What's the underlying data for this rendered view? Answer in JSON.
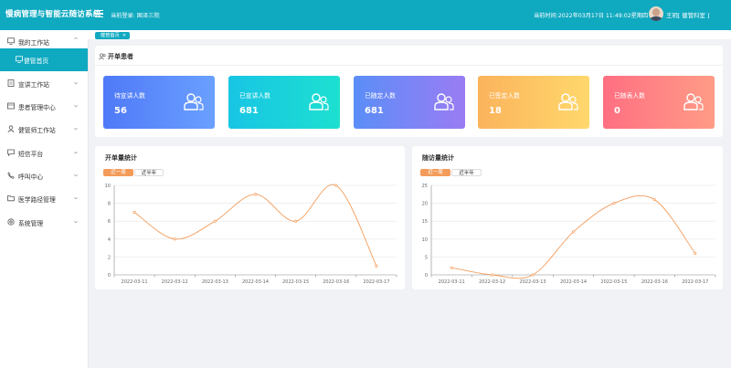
{
  "header": {
    "title": "慢病管理与智能云随访系统",
    "login_text": "当前登录: 国泽三院",
    "time_text": "当前时间:2022年03月17日 11:49:02星期四",
    "user_text": "王玥[ 健管科室 ]"
  },
  "sidebar": {
    "items": [
      {
        "label": "我的工作站",
        "icon": "monitor-icon"
      },
      {
        "label": "健管首页",
        "icon": "monitor-icon"
      },
      {
        "label": "宣讲工作站",
        "icon": "doc-icon"
      },
      {
        "label": "患者管理中心",
        "icon": "card-icon"
      },
      {
        "label": "健管师工作站",
        "icon": "user-icon"
      },
      {
        "label": "短信平台",
        "icon": "chat-icon"
      },
      {
        "label": "呼叫中心",
        "icon": "phone-icon"
      },
      {
        "label": "医学路径管理",
        "icon": "folder-icon"
      },
      {
        "label": "系统管理",
        "icon": "gear-icon"
      }
    ]
  },
  "tabbar": {
    "active_tab": "健管首页",
    "close": "×"
  },
  "patients": {
    "title": "开单患者",
    "tiles": [
      {
        "label": "待宣讲人数",
        "value": "56",
        "from": "#4f79f7",
        "to": "#6aa0ff"
      },
      {
        "label": "已宣讲人数",
        "value": "681",
        "from": "#18c5e4",
        "to": "#1de0d0"
      },
      {
        "label": "已随定人数",
        "value": "681",
        "from": "#5b8ef7",
        "to": "#9a7cf4"
      },
      {
        "label": "已签定人数",
        "value": "18",
        "from": "#fbb35c",
        "to": "#ffd86c"
      },
      {
        "label": "已随表人数",
        "value": "0",
        "from": "#ff6f82",
        "to": "#ff9c86"
      }
    ]
  },
  "charts": {
    "left": {
      "title": "开单量统计",
      "tab_on": "近一周",
      "tab_off": "近半年"
    },
    "right": {
      "title": "随访量统计",
      "tab_on": "近一周",
      "tab_off": "近半年"
    }
  },
  "chart_data": [
    {
      "type": "line",
      "title": "开单量统计",
      "x": [
        "2022-03-11",
        "2022-03-12",
        "2022-03-13",
        "2022-03-14",
        "2022-03-15",
        "2022-03-16",
        "2022-03-17"
      ],
      "series": [
        {
          "values": [
            7,
            4,
            6,
            9,
            6,
            10,
            1
          ]
        }
      ],
      "ylim": [
        0,
        10
      ],
      "yticks": [
        0,
        2,
        4,
        6,
        8,
        10
      ],
      "color": "#f39c5a",
      "grid": true
    },
    {
      "type": "line",
      "title": "随访量统计",
      "x": [
        "2022-03-11",
        "2022-03-12",
        "2022-03-13",
        "2022-03-14",
        "2022-03-15",
        "2022-03-16",
        "2022-03-17"
      ],
      "series": [
        {
          "values": [
            2,
            0,
            0,
            12,
            20,
            21,
            6
          ]
        }
      ],
      "ylim": [
        0,
        25
      ],
      "yticks": [
        0,
        5,
        10,
        15,
        20,
        25
      ],
      "color": "#f39c5a",
      "grid": true
    }
  ]
}
